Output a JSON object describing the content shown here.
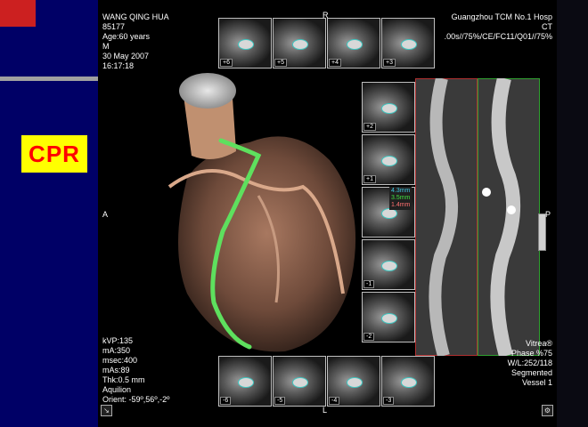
{
  "badge": {
    "label": "CPR"
  },
  "patient": {
    "name": "WANG QING HUA",
    "id": "85177",
    "age": "Age:60 years",
    "sex": "M",
    "date": "30 May 2007",
    "time": "16:17:18"
  },
  "site": {
    "hospital": "Guangzhou TCM No.1 Hosp",
    "modality": "CT",
    "protocol": ".00s//75%/CE/FC11/Q01//75%"
  },
  "scan": {
    "kvp": "kVP:135",
    "ma": "mA:350",
    "msec": "msec:400",
    "mas": "mAs:89",
    "thk": "Thk:0.5 mm",
    "scanner": "Aquilion",
    "orient": "Orient: -59º,56º,-2º"
  },
  "render": {
    "vendor": "Vitrea®",
    "phase": "Phase %75",
    "wl": "W/L:252/118",
    "mode": "Segmented",
    "vessel": "Vessel 1"
  },
  "orientation": {
    "top": "R",
    "bottom": "L",
    "left": "A",
    "right": "P"
  },
  "thumbs_top": [
    "+6",
    "+5",
    "+4",
    "+3"
  ],
  "thumbs_right": [
    "+2",
    "+1",
    "",
    "-1",
    "-2"
  ],
  "thumbs_bottom": [
    "-6",
    "-5",
    "-4",
    "-3"
  ],
  "measurements": [
    "4.3mm",
    "3.5mm",
    "1.4mm"
  ],
  "colors": {
    "vessel": "#5ee05e",
    "heart": "#b07a5a",
    "cpr_frame_left": "#b03030",
    "cpr_frame_right": "#30a030",
    "badge_bg": "#ffff00",
    "badge_text": "#ff0000"
  }
}
